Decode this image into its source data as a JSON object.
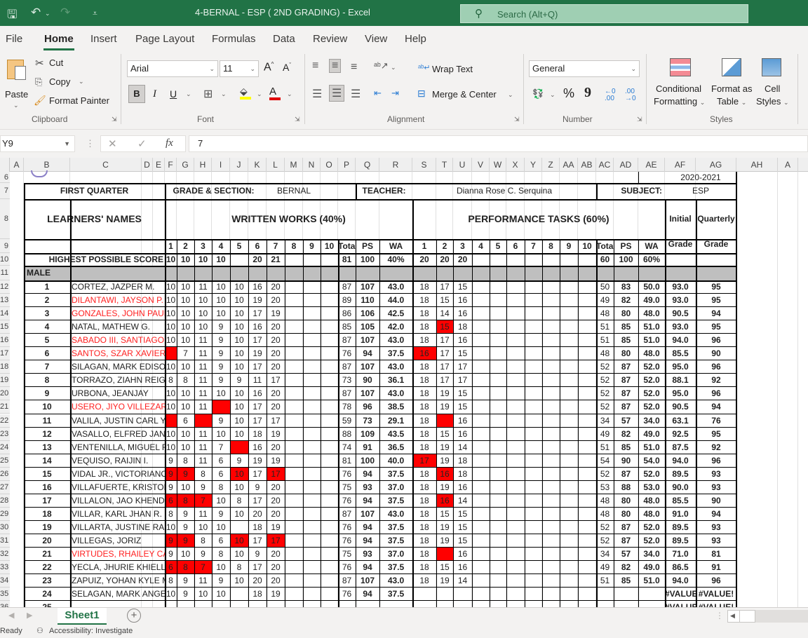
{
  "app": {
    "title": "4-BERNAL - ESP ( 2ND GRADING)  -  Excel",
    "search_placeholder": "Search (Alt+Q)"
  },
  "menu": [
    "File",
    "Home",
    "Insert",
    "Page Layout",
    "Formulas",
    "Data",
    "Review",
    "View",
    "Help"
  ],
  "ribbon": {
    "clipboard": {
      "paste": "Paste",
      "cut": "Cut",
      "copy": "Copy",
      "format_painter": "Format Painter",
      "label": "Clipboard"
    },
    "font": {
      "name": "Arial",
      "size": "11",
      "label": "Font",
      "bold": "B",
      "italic": "I",
      "underline": "U"
    },
    "alignment": {
      "wrap_text": "Wrap Text",
      "merge_center": "Merge & Center",
      "label": "Alignment"
    },
    "number": {
      "format": "General",
      "label": "Number",
      "percent": "%",
      "comma": "9"
    },
    "styles": {
      "conditional": "Conditional",
      "conditional2": "Formatting",
      "format_as": "Format as",
      "format_as2": "Table",
      "cell": "Cell",
      "cell2": "Styles",
      "label": "Styles"
    }
  },
  "formula_bar": {
    "name_box": "Y9",
    "value": "7"
  },
  "columns": [
    "A",
    "B",
    "C",
    "D",
    "E",
    "F",
    "G",
    "H",
    "I",
    "J",
    "K",
    "L",
    "M",
    "N",
    "O",
    "P",
    "Q",
    "R",
    "S",
    "T",
    "U",
    "V",
    "W",
    "X",
    "Y",
    "Z",
    "AA",
    "AB",
    "AC",
    "AD",
    "AE",
    "AF",
    "AG",
    "AH",
    "A"
  ],
  "sheet": {
    "school_year": "2020-2021",
    "quarter": "FIRST QUARTER",
    "grade_section_label": "GRADE & SECTION:",
    "grade_section": "BERNAL",
    "teacher_label": "TEACHER:",
    "teacher": "Dianna Rose C. Serquina",
    "subject_label": "SUBJECT:",
    "subject": "ESP",
    "learners_header": "LEARNERS' NAMES",
    "ww_header": "WRITTEN WORKS (40%)",
    "pt_header": "PERFORMANCE TASKS (60%)",
    "initial_grade": "Initial",
    "quarterly_grade": "Quarterly",
    "grade_word": "Grade",
    "sub_headers": {
      "nums": [
        "1",
        "2",
        "3",
        "4",
        "5",
        "6",
        "7",
        "8",
        "9",
        "10"
      ],
      "total": "Total",
      "ps": "PS",
      "wa": "WA"
    },
    "hps_label": "HIGHEST POSSIBLE SCORE",
    "hps": {
      "ww": [
        "10",
        "10",
        "10",
        "10",
        "",
        "20",
        "21",
        "",
        "",
        ""
      ],
      "ww_total": "81",
      "ww_ps": "100",
      "ww_wa": "40%",
      "pt": [
        "20",
        "20",
        "20",
        "",
        "",
        "",
        "",
        "",
        "",
        ""
      ],
      "pt_total": "60",
      "pt_ps": "100",
      "pt_wa": "60%"
    },
    "male_label": "MALE",
    "learners": [
      {
        "no": "1",
        "name": "CORTEZ, JAZPER M.",
        "red": false,
        "ww": [
          "10",
          "10",
          "11",
          "10",
          "10",
          "16",
          "20"
        ],
        "ww_red": [],
        "ww_total": "87",
        "ww_ps": "107",
        "ww_wa": "43.0",
        "pt": [
          "18",
          "17",
          "15"
        ],
        "pt_red": [],
        "pt_total": "50",
        "pt_ps": "83",
        "pt_wa": "50.0",
        "initial": "93.0",
        "quarterly": "95"
      },
      {
        "no": "2",
        "name": "DILANTAWI, JAYSON P.",
        "red": true,
        "ww": [
          "10",
          "10",
          "10",
          "10",
          "10",
          "19",
          "20"
        ],
        "ww_red": [],
        "ww_total": "89",
        "ww_ps": "110",
        "ww_wa": "44.0",
        "pt": [
          "18",
          "15",
          "16"
        ],
        "pt_red": [],
        "pt_total": "49",
        "pt_ps": "82",
        "pt_wa": "49.0",
        "initial": "93.0",
        "quarterly": "95"
      },
      {
        "no": "3",
        "name": "GONZALES, JOHN PAUL V.",
        "red": true,
        "ww": [
          "10",
          "10",
          "10",
          "10",
          "10",
          "17",
          "19"
        ],
        "ww_red": [],
        "ww_total": "86",
        "ww_ps": "106",
        "ww_wa": "42.5",
        "pt": [
          "18",
          "14",
          "16"
        ],
        "pt_red": [],
        "pt_total": "48",
        "pt_ps": "80",
        "pt_wa": "48.0",
        "initial": "90.5",
        "quarterly": "94"
      },
      {
        "no": "4",
        "name": "NATAL, MATHEW G.",
        "red": false,
        "ww": [
          "10",
          "10",
          "10",
          "9",
          "10",
          "16",
          "20"
        ],
        "ww_red": [],
        "ww_total": "85",
        "ww_ps": "105",
        "ww_wa": "42.0",
        "pt": [
          "18",
          "15",
          "18"
        ],
        "pt_red": [
          1
        ],
        "pt_total": "51",
        "pt_ps": "85",
        "pt_wa": "51.0",
        "initial": "93.0",
        "quarterly": "95"
      },
      {
        "no": "5",
        "name": "SABADO III, SANTIAGO C.",
        "red": true,
        "ww": [
          "10",
          "10",
          "11",
          "9",
          "10",
          "17",
          "20"
        ],
        "ww_red": [],
        "ww_total": "87",
        "ww_ps": "107",
        "ww_wa": "43.0",
        "pt": [
          "18",
          "17",
          "16"
        ],
        "pt_red": [],
        "pt_total": "51",
        "pt_ps": "85",
        "pt_wa": "51.0",
        "initial": "94.0",
        "quarterly": "96"
      },
      {
        "no": "6",
        "name": "SANTOS, SZAR XAVIER C.",
        "red": true,
        "ww": [
          "",
          "7",
          "11",
          "9",
          "10",
          "19",
          "20"
        ],
        "ww_red": [
          0
        ],
        "ww_total": "76",
        "ww_ps": "94",
        "ww_wa": "37.5",
        "pt": [
          "16",
          "17",
          "15"
        ],
        "pt_red": [
          0
        ],
        "pt_total": "48",
        "pt_ps": "80",
        "pt_wa": "48.0",
        "initial": "85.5",
        "quarterly": "90"
      },
      {
        "no": "7",
        "name": "SILAGAN, MARK EDISON V.",
        "red": false,
        "ww": [
          "10",
          "10",
          "11",
          "9",
          "10",
          "17",
          "20"
        ],
        "ww_red": [],
        "ww_total": "87",
        "ww_ps": "107",
        "ww_wa": "43.0",
        "pt": [
          "18",
          "17",
          "17"
        ],
        "pt_red": [],
        "pt_total": "52",
        "pt_ps": "87",
        "pt_wa": "52.0",
        "initial": "95.0",
        "quarterly": "96"
      },
      {
        "no": "8",
        "name": "TORRAZO, ZIAHN REIGN F.",
        "red": false,
        "ww": [
          "8",
          "8",
          "11",
          "9",
          "9",
          "11",
          "17"
        ],
        "ww_red": [],
        "ww_total": "73",
        "ww_ps": "90",
        "ww_wa": "36.1",
        "pt": [
          "18",
          "17",
          "17"
        ],
        "pt_red": [],
        "pt_total": "52",
        "pt_ps": "87",
        "pt_wa": "52.0",
        "initial": "88.1",
        "quarterly": "92"
      },
      {
        "no": "9",
        "name": "URBONA, JEANJAY",
        "red": false,
        "ww": [
          "10",
          "10",
          "11",
          "10",
          "10",
          "16",
          "20"
        ],
        "ww_red": [],
        "ww_total": "87",
        "ww_ps": "107",
        "ww_wa": "43.0",
        "pt": [
          "18",
          "19",
          "15"
        ],
        "pt_red": [],
        "pt_total": "52",
        "pt_ps": "87",
        "pt_wa": "52.0",
        "initial": "95.0",
        "quarterly": "96"
      },
      {
        "no": "10",
        "name": "USERO, JIYO VILLEZAR",
        "red": true,
        "ww": [
          "10",
          "10",
          "11",
          "",
          "10",
          "17",
          "20"
        ],
        "ww_red": [
          3
        ],
        "ww_total": "78",
        "ww_ps": "96",
        "ww_wa": "38.5",
        "pt": [
          "18",
          "19",
          "15"
        ],
        "pt_red": [],
        "pt_total": "52",
        "pt_ps": "87",
        "pt_wa": "52.0",
        "initial": "90.5",
        "quarterly": "94"
      },
      {
        "no": "11",
        "name": "VALILA, JUSTIN CARL Y.",
        "red": false,
        "ww": [
          "",
          "6",
          "",
          "9",
          "10",
          "17",
          "17"
        ],
        "ww_red": [
          0,
          2
        ],
        "ww_total": "59",
        "ww_ps": "73",
        "ww_wa": "29.1",
        "pt": [
          "18",
          "",
          "16"
        ],
        "pt_red": [
          1
        ],
        "pt_total": "34",
        "pt_ps": "57",
        "pt_wa": "34.0",
        "initial": "63.1",
        "quarterly": "76"
      },
      {
        "no": "12",
        "name": "VASALLO, ELFRED JAN ANDAL",
        "red": false,
        "ww": [
          "10",
          "10",
          "11",
          "10",
          "10",
          "18",
          "19"
        ],
        "ww_red": [],
        "ww_total": "88",
        "ww_ps": "109",
        "ww_wa": "43.5",
        "pt": [
          "18",
          "15",
          "16"
        ],
        "pt_red": [],
        "pt_total": "49",
        "pt_ps": "82",
        "pt_wa": "49.0",
        "initial": "92.5",
        "quarterly": "95"
      },
      {
        "no": "13",
        "name": "VENTENILLA, MIGUEL RAYMUNDO O.",
        "red": false,
        "ww": [
          "10",
          "10",
          "11",
          "7",
          "",
          "16",
          "20"
        ],
        "ww_red": [
          4
        ],
        "ww_total": "74",
        "ww_ps": "91",
        "ww_wa": "36.5",
        "pt": [
          "18",
          "19",
          "14"
        ],
        "pt_red": [],
        "pt_total": "51",
        "pt_ps": "85",
        "pt_wa": "51.0",
        "initial": "87.5",
        "quarterly": "92"
      },
      {
        "no": "14",
        "name": "VEQUISO, RAIJIN I.",
        "red": false,
        "ww": [
          "9",
          "8",
          "11",
          "6",
          "9",
          "19",
          "19"
        ],
        "ww_red": [],
        "ww_total": "81",
        "ww_ps": "100",
        "ww_wa": "40.0",
        "pt": [
          "17",
          "19",
          "18"
        ],
        "pt_red": [
          0
        ],
        "pt_total": "54",
        "pt_ps": "90",
        "pt_wa": "54.0",
        "initial": "94.0",
        "quarterly": "96"
      },
      {
        "no": "15",
        "name": "VIDAL JR., VICTORIANO C.",
        "red": false,
        "ww": [
          "9",
          "9",
          "8",
          "6",
          "10",
          "17",
          "17"
        ],
        "ww_red": [
          0,
          1,
          4,
          6
        ],
        "ww_total": "76",
        "ww_ps": "94",
        "ww_wa": "37.5",
        "pt": [
          "18",
          "16",
          "18"
        ],
        "pt_red": [
          1
        ],
        "pt_total": "52",
        "pt_ps": "87",
        "pt_wa": "52.0",
        "initial": "89.5",
        "quarterly": "93"
      },
      {
        "no": "16",
        "name": "VILLAFUERTE, KRISTOFFE",
        "red": false,
        "ww": [
          "9",
          "10",
          "9",
          "8",
          "10",
          "9",
          "20"
        ],
        "ww_red": [],
        "ww_total": "75",
        "ww_ps": "93",
        "ww_wa": "37.0",
        "pt": [
          "18",
          "19",
          "16"
        ],
        "pt_red": [],
        "pt_total": "53",
        "pt_ps": "88",
        "pt_wa": "53.0",
        "initial": "90.0",
        "quarterly": "93"
      },
      {
        "no": "17",
        "name": "VILLALON, JAO KHENDRICK L.",
        "red": false,
        "ww": [
          "6",
          "8",
          "7",
          "10",
          "8",
          "17",
          "20"
        ],
        "ww_red": [
          0,
          1,
          2
        ],
        "ww_total": "76",
        "ww_ps": "94",
        "ww_wa": "37.5",
        "pt": [
          "18",
          "16",
          "14"
        ],
        "pt_red": [
          1
        ],
        "pt_total": "48",
        "pt_ps": "80",
        "pt_wa": "48.0",
        "initial": "85.5",
        "quarterly": "90"
      },
      {
        "no": "18",
        "name": "VILLAR, KARL JHAN R.",
        "red": false,
        "ww": [
          "8",
          "9",
          "11",
          "9",
          "10",
          "20",
          "20"
        ],
        "ww_red": [],
        "ww_total": "87",
        "ww_ps": "107",
        "ww_wa": "43.0",
        "pt": [
          "18",
          "15",
          "15"
        ],
        "pt_red": [],
        "pt_total": "48",
        "pt_ps": "80",
        "pt_wa": "48.0",
        "initial": "91.0",
        "quarterly": "94"
      },
      {
        "no": "19",
        "name": "VILLARTA, JUSTINE RAIN G.",
        "red": false,
        "ww": [
          "10",
          "9",
          "10",
          "10",
          "",
          "18",
          "19"
        ],
        "ww_red": [],
        "ww_total": "76",
        "ww_ps": "94",
        "ww_wa": "37.5",
        "pt": [
          "18",
          "19",
          "15"
        ],
        "pt_red": [],
        "pt_total": "52",
        "pt_ps": "87",
        "pt_wa": "52.0",
        "initial": "89.5",
        "quarterly": "93"
      },
      {
        "no": "20",
        "name": "VILLEGAS, JORIZ",
        "red": false,
        "ww": [
          "9",
          "9",
          "8",
          "6",
          "10",
          "17",
          "17"
        ],
        "ww_red": [
          0,
          1,
          4,
          6
        ],
        "ww_total": "76",
        "ww_ps": "94",
        "ww_wa": "37.5",
        "pt": [
          "18",
          "19",
          "15"
        ],
        "pt_red": [],
        "pt_total": "52",
        "pt_ps": "87",
        "pt_wa": "52.0",
        "initial": "89.5",
        "quarterly": "93"
      },
      {
        "no": "21",
        "name": "VIRTUDES, RHAILEY CARL P.",
        "red": true,
        "ww": [
          "9",
          "10",
          "9",
          "8",
          "10",
          "9",
          "20"
        ],
        "ww_red": [],
        "ww_total": "75",
        "ww_ps": "93",
        "ww_wa": "37.0",
        "pt": [
          "18",
          "",
          "16"
        ],
        "pt_red": [
          1
        ],
        "pt_total": "34",
        "pt_ps": "57",
        "pt_wa": "34.0",
        "initial": "71.0",
        "quarterly": "81"
      },
      {
        "no": "22",
        "name": "YECLA, JHURIE KHIELL",
        "red": false,
        "ww": [
          "6",
          "8",
          "7",
          "10",
          "8",
          "17",
          "20"
        ],
        "ww_red": [
          0,
          1,
          2
        ],
        "ww_total": "76",
        "ww_ps": "94",
        "ww_wa": "37.5",
        "pt": [
          "18",
          "15",
          "16"
        ],
        "pt_red": [],
        "pt_total": "49",
        "pt_ps": "82",
        "pt_wa": "49.0",
        "initial": "86.5",
        "quarterly": "91"
      },
      {
        "no": "23",
        "name": "ZAPUIZ, YOHAN KYLE M.",
        "red": false,
        "ww": [
          "8",
          "9",
          "11",
          "9",
          "10",
          "20",
          "20"
        ],
        "ww_red": [],
        "ww_total": "87",
        "ww_ps": "107",
        "ww_wa": "43.0",
        "pt": [
          "18",
          "19",
          "14"
        ],
        "pt_red": [],
        "pt_total": "51",
        "pt_ps": "85",
        "pt_wa": "51.0",
        "initial": "94.0",
        "quarterly": "96"
      },
      {
        "no": "24",
        "name": "SELAGAN, MARK ANGELO (modular)",
        "red": false,
        "ww": [
          "10",
          "9",
          "10",
          "10",
          "",
          "18",
          "19"
        ],
        "ww_red": [],
        "ww_total": "76",
        "ww_ps": "94",
        "ww_wa": "37.5",
        "pt": [
          "",
          "",
          ""
        ],
        "pt_red": [],
        "pt_total": "",
        "pt_ps": "",
        "pt_wa": "",
        "initial": "#VALUE!",
        "quarterly": "#VALUE!"
      },
      {
        "no": "25",
        "name": "",
        "red": false,
        "ww": [
          "",
          "",
          "",
          "",
          "",
          "",
          ""
        ],
        "ww_red": [],
        "ww_total": "",
        "ww_ps": "",
        "ww_wa": "",
        "pt": [
          "",
          "",
          ""
        ],
        "pt_red": [],
        "pt_total": "",
        "pt_ps": "",
        "pt_wa": "",
        "initial": "#VALUE!",
        "quarterly": "#VALUE!"
      }
    ]
  },
  "sheet_tabs": {
    "active": "Sheet1"
  },
  "status": {
    "ready": "Ready",
    "accessibility": "Accessibility: Investigate"
  },
  "colors": {
    "excel_green": "#217346",
    "highlight_red": "#ff0000",
    "name_red": "#ff2020"
  }
}
